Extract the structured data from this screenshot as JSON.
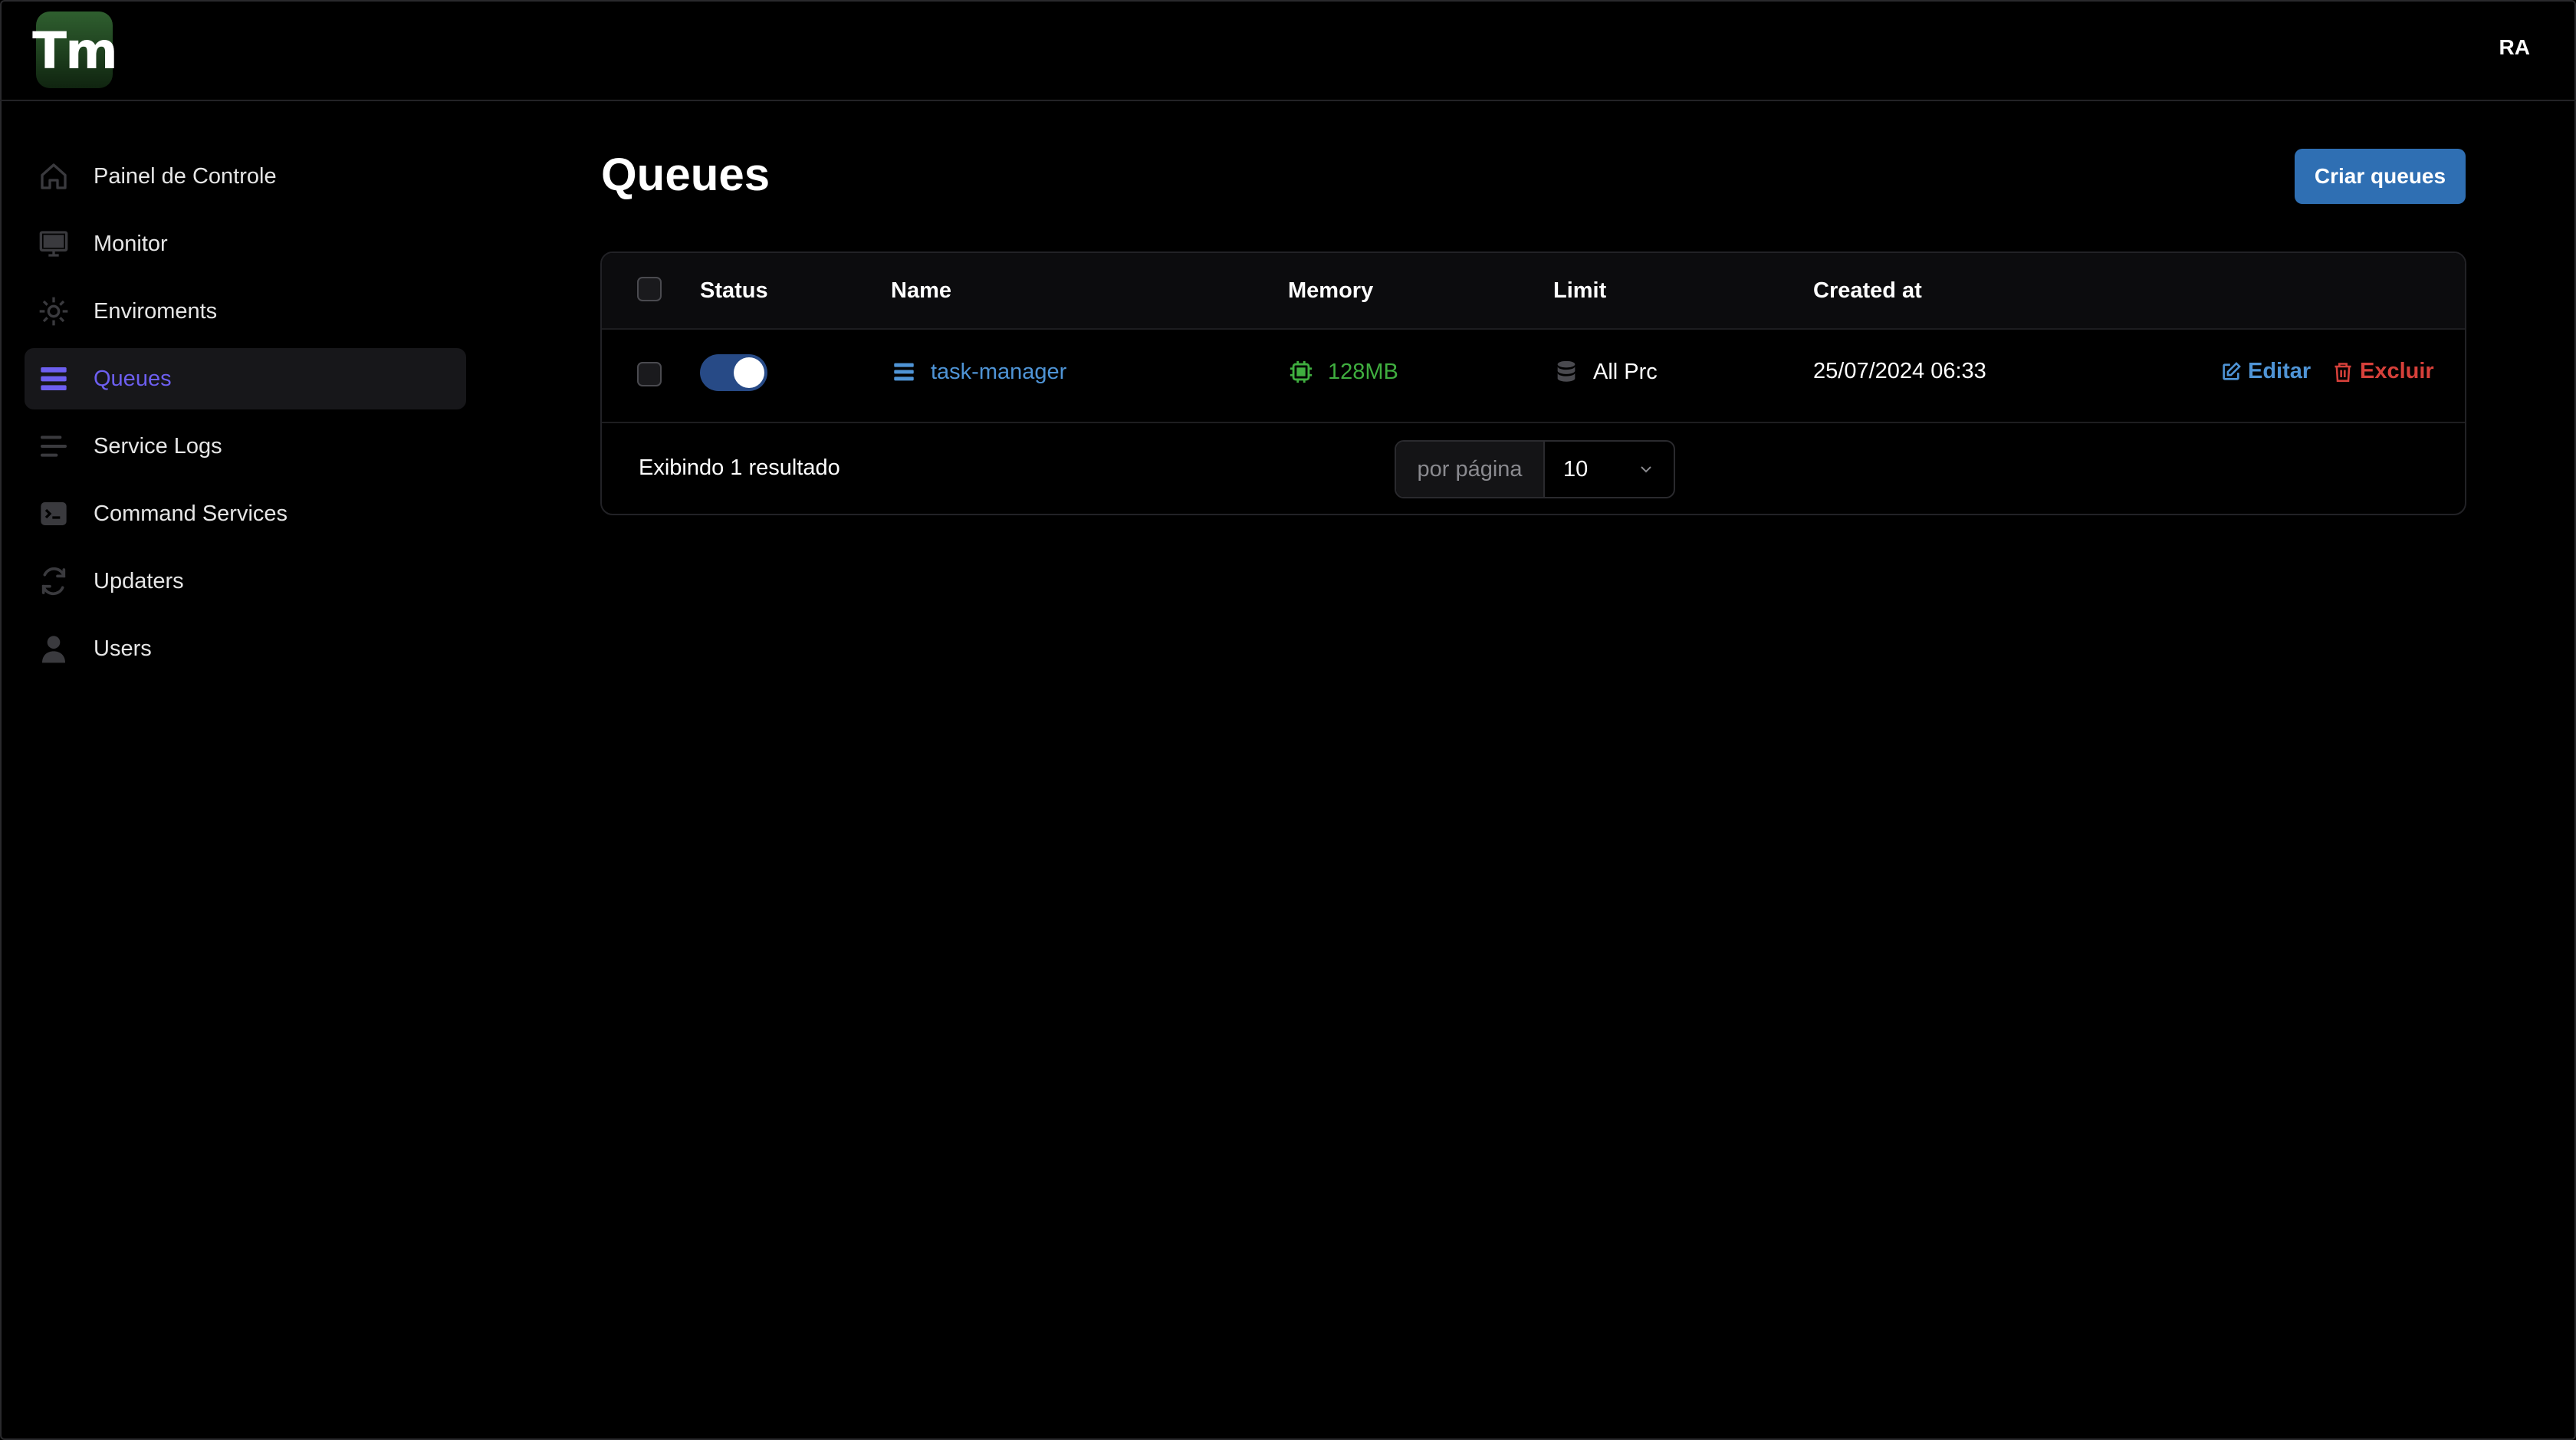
{
  "app": {
    "logo_text": "Tm",
    "user_initials": "RA"
  },
  "sidebar": {
    "items": [
      {
        "label": "Painel de Controle",
        "icon": "home-icon"
      },
      {
        "label": "Monitor",
        "icon": "monitor-icon"
      },
      {
        "label": "Enviroments",
        "icon": "gear-icon"
      },
      {
        "label": "Queues",
        "icon": "queue-stack-icon",
        "active": true
      },
      {
        "label": "Service Logs",
        "icon": "log-lines-icon"
      },
      {
        "label": "Command Services",
        "icon": "terminal-icon"
      },
      {
        "label": "Updaters",
        "icon": "refresh-icon"
      },
      {
        "label": "Users",
        "icon": "user-icon"
      }
    ]
  },
  "page": {
    "title": "Queues",
    "create_button": "Criar queues"
  },
  "table": {
    "columns": {
      "status": "Status",
      "name": "Name",
      "memory": "Memory",
      "limit": "Limit",
      "created_at": "Created at"
    },
    "rows": [
      {
        "status_enabled": true,
        "name": "task-manager",
        "memory": "128MB",
        "limit": "All Prc",
        "created_at": "25/07/2024 06:33",
        "edit_label": "Editar",
        "delete_label": "Excluir"
      }
    ],
    "footer": {
      "results_text": "Exibindo 1 resultado",
      "per_page_label": "por página",
      "per_page_value": "10"
    }
  },
  "colors": {
    "accent_active": "#6d5ff0",
    "primary_button": "#2f6fb3",
    "link": "#4f94d6",
    "memory": "#3fae3f",
    "danger": "#d6403a"
  }
}
